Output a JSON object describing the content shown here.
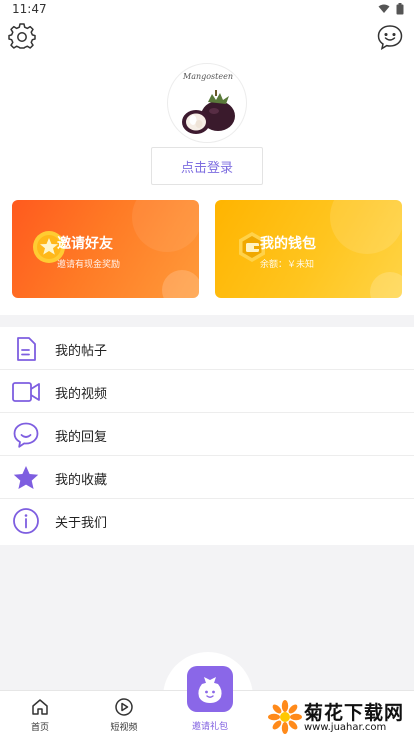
{
  "status_bar": {
    "time": "11:47"
  },
  "header": {
    "avatar_caption": "Mangosteen",
    "login_label": "点击登录"
  },
  "cards": {
    "invite": {
      "title": "邀请好友",
      "subtitle": "邀请有现金奖励"
    },
    "wallet": {
      "title": "我的钱包",
      "subtitle": "余额：￥未知"
    }
  },
  "menu": {
    "items": [
      {
        "label": "我的帖子",
        "icon": "document-icon"
      },
      {
        "label": "我的视频",
        "icon": "video-camera-icon"
      },
      {
        "label": "我的回复",
        "icon": "chat-bubble-icon"
      },
      {
        "label": "我的收藏",
        "icon": "star-icon"
      },
      {
        "label": "关于我们",
        "icon": "info-icon"
      }
    ]
  },
  "tabbar": {
    "home": "首页",
    "short_video": "短视频",
    "invite_gift": "邀请礼包"
  },
  "watermark": {
    "text": "菊花下载网",
    "url": "www.juahar.com"
  },
  "colors": {
    "accent": "#7e6ee0",
    "invite_card": "#ff6a20",
    "wallet_card": "#ffc20e"
  }
}
